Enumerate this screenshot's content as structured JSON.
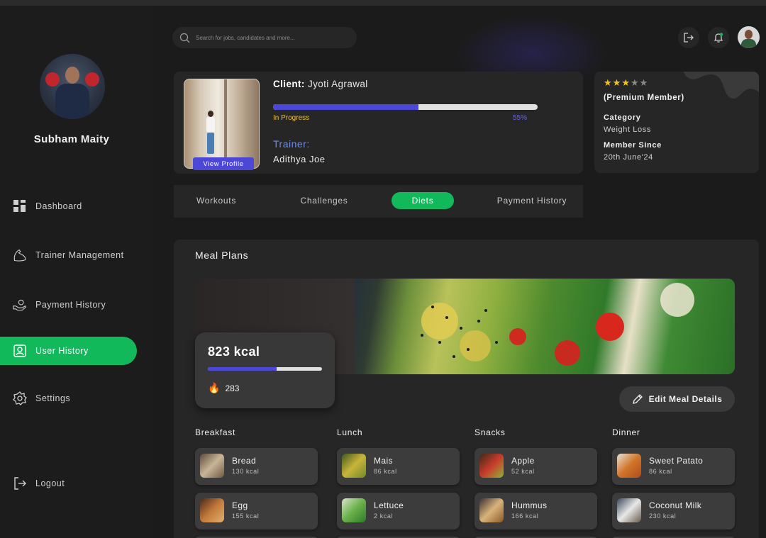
{
  "user": {
    "name": "Subham Maity"
  },
  "nav": {
    "items": [
      {
        "label": "Dashboard",
        "icon": "grid-icon"
      },
      {
        "label": "Trainer Management",
        "icon": "bicep-icon"
      },
      {
        "label": "Payment History",
        "icon": "hand-money-icon"
      },
      {
        "label": "User History",
        "icon": "user-card-icon",
        "active": true
      },
      {
        "label": "Settings",
        "icon": "gear-icon"
      }
    ],
    "logout": "Logout"
  },
  "search": {
    "placeholder": "Search for jobs, candidates and more..."
  },
  "client": {
    "label": "Client:",
    "name": "Jyoti Agrawal",
    "status": "In Progress",
    "progress_percent": 55,
    "progress_text": "55%",
    "trainer_label": "Trainer:",
    "trainer_name": "Adithya Joe",
    "view_profile": "View Profile"
  },
  "member": {
    "stars_filled": 3,
    "stars_total": 5,
    "type": "(Premium Member)",
    "category_label": "Category",
    "category_value": "Weight Loss",
    "since_label": "Member Since",
    "since_value": "20th June'24"
  },
  "tabs": [
    {
      "label": "Workouts"
    },
    {
      "label": "Challenges"
    },
    {
      "label": "Diets",
      "active": true
    },
    {
      "label": "Payment History"
    }
  ],
  "meal": {
    "title": "Meal Plans",
    "kcal": "823 kcal",
    "kcal_fraction": 0.6,
    "burned": "283",
    "edit_button": "Edit Meal Details",
    "columns": [
      {
        "title": "Breakfast",
        "foods": [
          {
            "name": "Bread",
            "kcal": "130 kcal"
          },
          {
            "name": "Egg",
            "kcal": "155 kcal"
          }
        ]
      },
      {
        "title": "Lunch",
        "foods": [
          {
            "name": "Mais",
            "kcal": "86 kcal"
          },
          {
            "name": "Lettuce",
            "kcal": "2 kcal"
          }
        ]
      },
      {
        "title": "Snacks",
        "foods": [
          {
            "name": "Apple",
            "kcal": "52 kcal"
          },
          {
            "name": "Hummus",
            "kcal": "166 kcal"
          }
        ]
      },
      {
        "title": "Dinner",
        "foods": [
          {
            "name": "Sweet Patato",
            "kcal": "86 kcal"
          },
          {
            "name": "Coconut Milk",
            "kcal": "230 kcal"
          }
        ]
      }
    ]
  },
  "colors": {
    "accent_green": "#12b95a",
    "accent_purple": "#4c47d6",
    "status_yellow": "#e9c43a",
    "star_yellow": "#f2c21b"
  }
}
